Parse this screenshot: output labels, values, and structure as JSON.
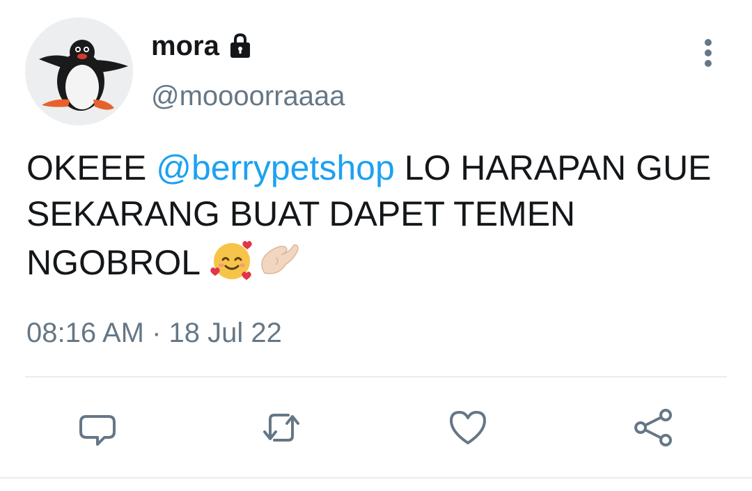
{
  "user": {
    "display_name": "mora",
    "handle": "@moooorraaaa",
    "protected_icon": "lock-icon",
    "avatar_icon": "penguin-avatar"
  },
  "tweet": {
    "text_before": "OKEEE ",
    "mention": "@berrypetshop",
    "text_after": " LO HARAPAN GUE SEKARANG BUAT DAPET TEMEN NGOBROL ",
    "emojis": [
      "smiling-face-with-hearts-emoji",
      "pinching-hand-emoji"
    ],
    "timestamp": "08:16 AM · 18 Jul 22"
  },
  "actions": [
    {
      "name": "reply",
      "icon": "reply-icon"
    },
    {
      "name": "retweet",
      "icon": "retweet-icon"
    },
    {
      "name": "like",
      "icon": "heart-icon"
    },
    {
      "name": "share",
      "icon": "share-icon"
    }
  ],
  "menu": {
    "icon": "more-vertical-icon"
  },
  "colors": {
    "text": "#14171a",
    "secondary": "#657786",
    "mention": "#1da1f2",
    "divider": "#e6ecf0"
  }
}
